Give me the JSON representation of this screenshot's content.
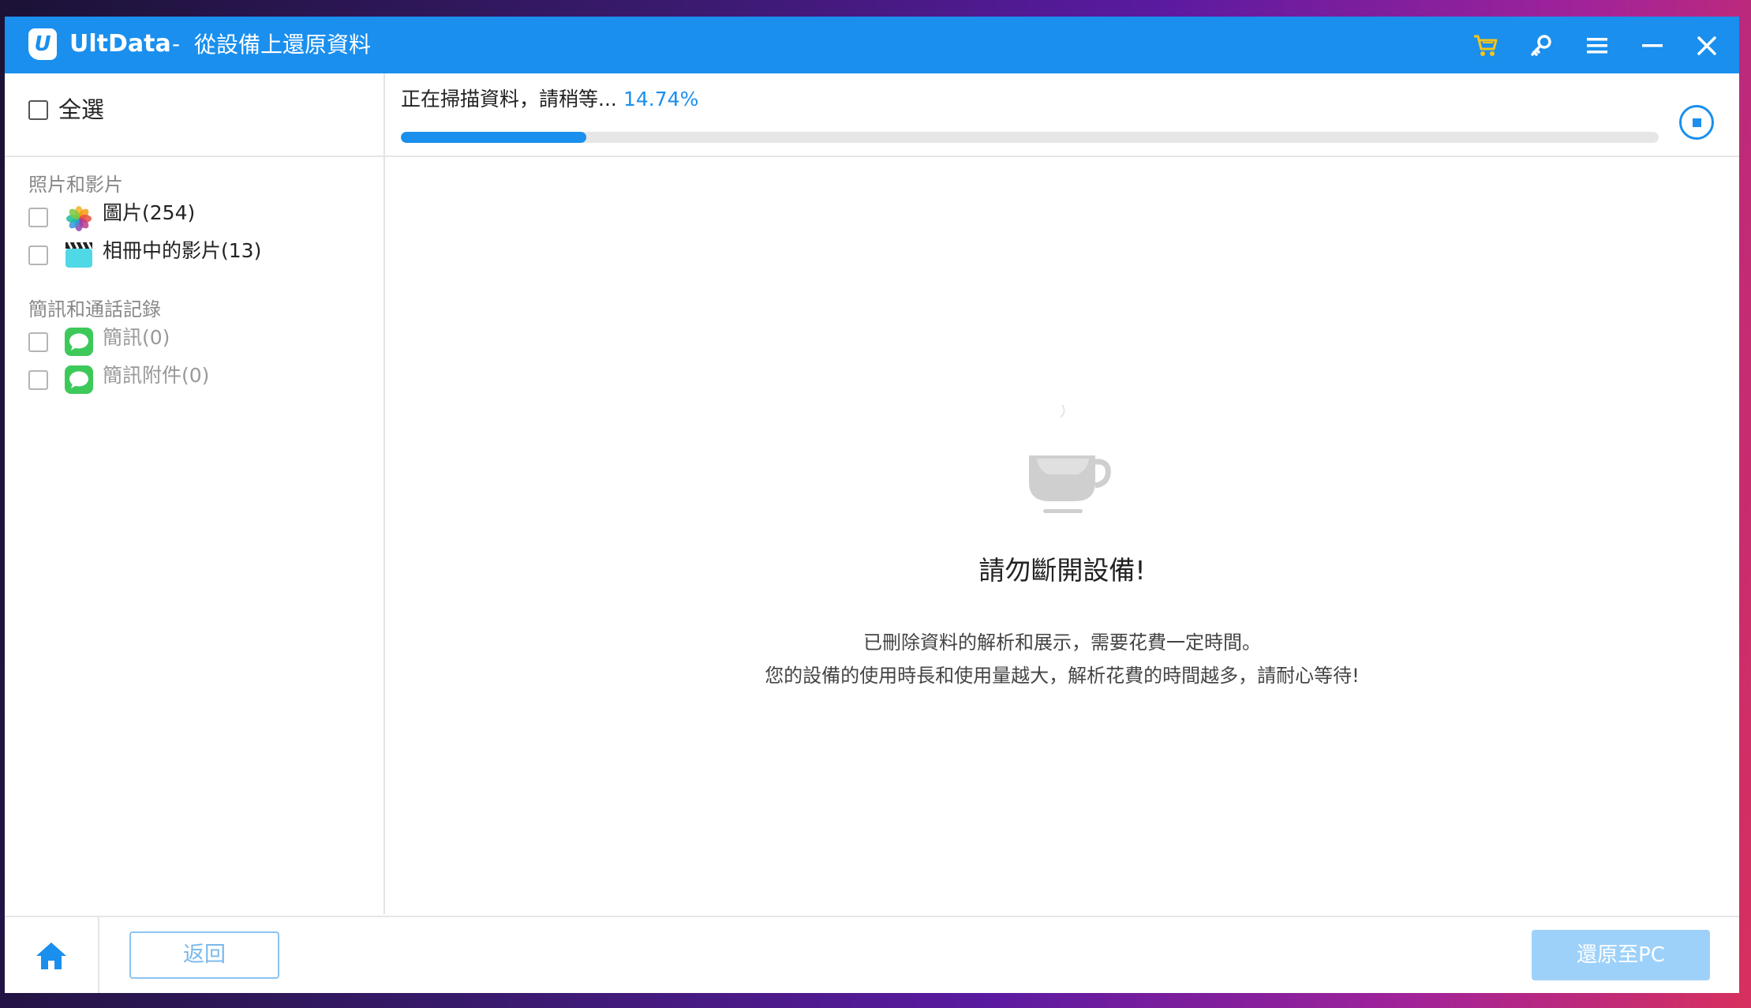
{
  "titlebar": {
    "app_name": "UltData",
    "separator": "-",
    "window_title": "從設備上還原資料",
    "icons": [
      "cart-icon",
      "key-icon",
      "menu-icon",
      "minimize-icon",
      "close-icon"
    ],
    "accent_color": "#1a8fee",
    "cart_color": "#f5c518"
  },
  "sidebar": {
    "select_all_label": "全選",
    "groups": [
      {
        "title": "照片和影片",
        "items": [
          {
            "label": "圖片(254)",
            "icon": "photos-icon"
          },
          {
            "label": "相冊中的影片(13)",
            "icon": "video-clapper-icon"
          }
        ]
      },
      {
        "title": "簡訊和通話記錄",
        "items": [
          {
            "label": "簡訊(0)",
            "icon": "messages-icon"
          },
          {
            "label": "簡訊附件(0)",
            "icon": "messages-icon"
          }
        ]
      }
    ]
  },
  "scan": {
    "status_text": "正在掃描資料，請稍等...",
    "percent_text": "14.74%",
    "progress_fraction": 0.1474
  },
  "message": {
    "headline": "請勿斷開設備!",
    "line1": "已刪除資料的解析和展示，需要花費一定時間。",
    "line2": "您的設備的使用時長和使用量越大，解析花費的時間越多，請耐心等待!"
  },
  "footer": {
    "back_label": "返回",
    "restore_label": "還原至PC"
  }
}
